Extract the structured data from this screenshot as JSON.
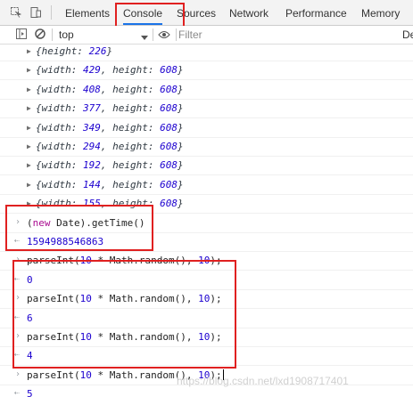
{
  "tabs": [
    {
      "label": "Elements",
      "active": false
    },
    {
      "label": "Console",
      "active": true
    },
    {
      "label": "Sources",
      "active": false
    },
    {
      "label": "Network",
      "active": false
    },
    {
      "label": "Performance",
      "active": false
    },
    {
      "label": "Memory",
      "active": false
    }
  ],
  "toolbar": {
    "context": "top",
    "filter_placeholder": "Filter",
    "right_cut_label": "De"
  },
  "logs": [
    {
      "kind": "object",
      "text": "{height: 226}"
    },
    {
      "kind": "object",
      "text": "{width: 429, height: 608}"
    },
    {
      "kind": "object",
      "text": "{width: 408, height: 608}"
    },
    {
      "kind": "object",
      "text": "{width: 377, height: 608}"
    },
    {
      "kind": "object",
      "text": "{width: 349, height: 608}"
    },
    {
      "kind": "object",
      "text": "{width: 294, height: 608}"
    },
    {
      "kind": "object",
      "text": "{width: 192, height: 608}"
    },
    {
      "kind": "object",
      "text": "{width: 144, height: 608}"
    },
    {
      "kind": "object",
      "text": "{width: 155, height: 608}"
    },
    {
      "kind": "command",
      "text": "(new Date).getTime()"
    },
    {
      "kind": "result",
      "text": "1594988546863"
    },
    {
      "kind": "command",
      "text": "parseInt(10 * Math.random(), 10);"
    },
    {
      "kind": "result",
      "text": "0"
    },
    {
      "kind": "command",
      "text": "parseInt(10 * Math.random(), 10);"
    },
    {
      "kind": "result",
      "text": "6"
    },
    {
      "kind": "command",
      "text": "parseInt(10 * Math.random(), 10);"
    },
    {
      "kind": "result",
      "text": "4"
    },
    {
      "kind": "command",
      "text": "parseInt(10 * Math.random(), 10);"
    },
    {
      "kind": "result",
      "text": "5"
    }
  ],
  "watermark": "https://blog.csdn.net/lxd1908717401",
  "colors": {
    "highlight_box": "#e02020",
    "result_number": "#1c00cf",
    "keyword": "#aa0d91"
  }
}
